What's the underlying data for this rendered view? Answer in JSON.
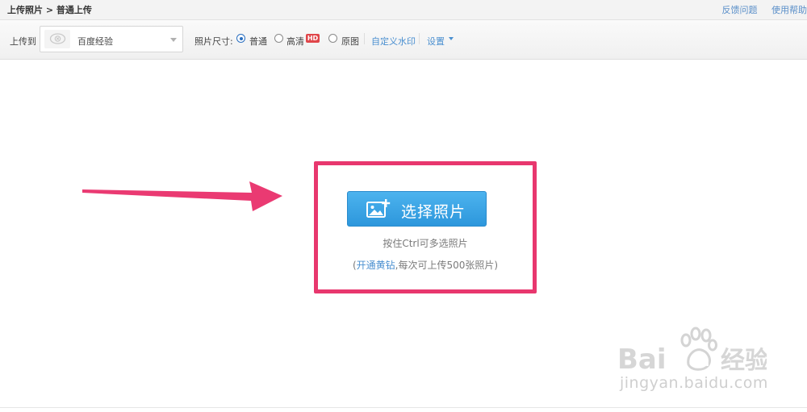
{
  "breadcrumb": {
    "text": "上传照片 > 普通上传"
  },
  "top_links": {
    "feedback": "反馈问题",
    "help": "使用帮助"
  },
  "toolbar": {
    "upload_to_label": "上传到",
    "album_selected": "百度经验",
    "photo_size_label": "照片尺寸:",
    "size_options": [
      {
        "label": "普通",
        "checked": true
      },
      {
        "label": "高清",
        "checked": false,
        "badge": "HD"
      },
      {
        "label": "原图",
        "checked": false
      }
    ],
    "watermark_link": "自定义水印",
    "settings_link": "设置"
  },
  "main": {
    "select_button_label": "选择照片",
    "hint_multi": "按住Ctrl可多选照片",
    "hint_open": "(",
    "hint_vip_link": "开通黄钻",
    "hint_rest": ",每次可上传500张照片)"
  },
  "watermark": {
    "site": "jingyan.baidu.com"
  },
  "colors": {
    "accent": "#4a8fd0",
    "highlight": "#e8376e",
    "button": "#2d97dc",
    "hd_badge": "#e0464a"
  }
}
